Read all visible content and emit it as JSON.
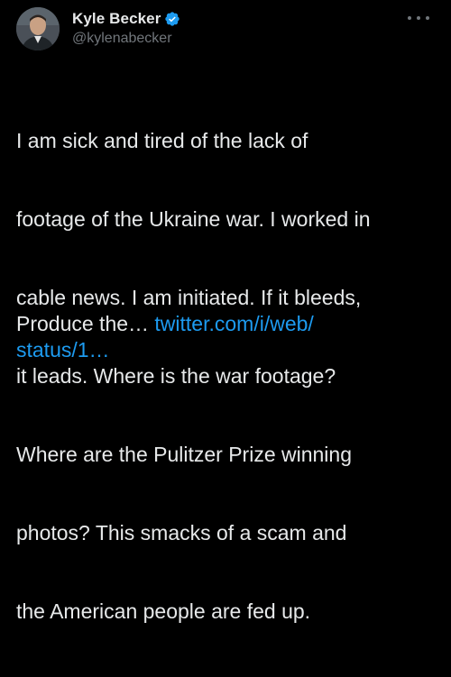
{
  "tweet": {
    "author": {
      "display_name": "Kyle Becker",
      "handle": "@kylenabecker",
      "verified": true,
      "avatar_icon": "profile-photo"
    },
    "more_icon": "more-horizontal-icon",
    "body_lines": [
      "I am sick and tired of the lack of",
      "footage of the Ukraine war. I worked in",
      "cable news. I am initiated. If it bleeds,",
      "it leads. Where is the war footage?",
      "Where are the Pulitzer Prize winning",
      "photos? This smacks of a scam and",
      "the American people are fed up."
    ],
    "truncated_text": "Produce the… ",
    "link_line1": "twitter.com/i/web/",
    "link_line2": "status/1…"
  },
  "colors": {
    "background": "#000000",
    "text": "#e7e9ea",
    "secondary": "#71767b",
    "link": "#1d9bf0",
    "verified": "#1d9bf0"
  }
}
